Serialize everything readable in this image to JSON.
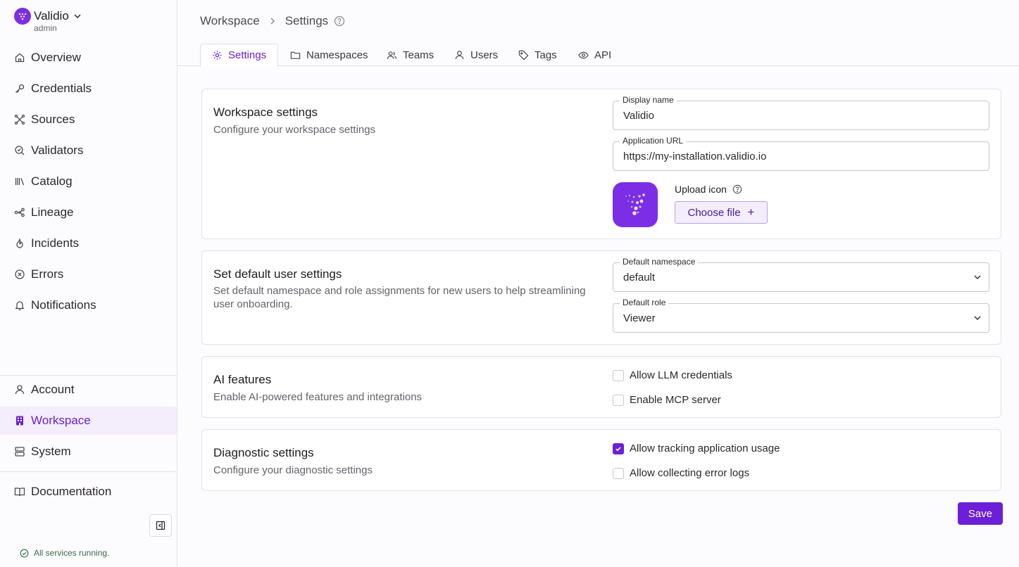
{
  "app": {
    "name": "Validio",
    "role": "admin"
  },
  "nav": {
    "main": [
      {
        "label": "Overview",
        "icon": "home-icon"
      },
      {
        "label": "Credentials",
        "icon": "key-icon"
      },
      {
        "label": "Sources",
        "icon": "sources-icon"
      },
      {
        "label": "Validators",
        "icon": "validator-icon"
      },
      {
        "label": "Catalog",
        "icon": "catalog-icon"
      },
      {
        "label": "Lineage",
        "icon": "lineage-icon"
      },
      {
        "label": "Incidents",
        "icon": "flame-icon"
      },
      {
        "label": "Errors",
        "icon": "error-icon"
      },
      {
        "label": "Notifications",
        "icon": "bell-icon"
      }
    ],
    "bottom": [
      {
        "label": "Account",
        "icon": "user-icon"
      },
      {
        "label": "Workspace",
        "icon": "building-icon",
        "active": true
      },
      {
        "label": "System",
        "icon": "server-icon"
      }
    ],
    "docs": {
      "label": "Documentation",
      "icon": "book-icon"
    }
  },
  "status": {
    "text": "All services running."
  },
  "breadcrumb": {
    "root": "Workspace",
    "current": "Settings"
  },
  "tabs": [
    {
      "label": "Settings",
      "icon": "gear-icon",
      "active": true
    },
    {
      "label": "Namespaces",
      "icon": "folder-icon"
    },
    {
      "label": "Teams",
      "icon": "users-icon"
    },
    {
      "label": "Users",
      "icon": "user-icon"
    },
    {
      "label": "Tags",
      "icon": "tag-icon"
    },
    {
      "label": "API",
      "icon": "eye-icon"
    }
  ],
  "workspace_settings": {
    "title": "Workspace settings",
    "description": "Configure your workspace settings",
    "display_name": {
      "label": "Display name",
      "value": "Validio"
    },
    "application_url": {
      "label": "Application URL",
      "value": "https://my-installation.validio.io"
    },
    "upload_icon_label": "Upload icon",
    "choose_file_label": "Choose file",
    "choose_file_plus": "+"
  },
  "default_user_settings": {
    "title": "Set default user settings",
    "description": "Set default namespace and role assignments for new users to help streamlining user onboarding.",
    "default_namespace": {
      "label": "Default namespace",
      "value": "default"
    },
    "default_role": {
      "label": "Default role",
      "value": "Viewer"
    }
  },
  "ai_features": {
    "title": "AI features",
    "description": "Enable AI-powered features and integrations",
    "options": [
      {
        "label": "Allow LLM credentials",
        "checked": false
      },
      {
        "label": "Enable MCP server",
        "checked": false
      }
    ]
  },
  "diagnostic_settings": {
    "title": "Diagnostic settings",
    "description": "Configure your diagnostic settings",
    "options": [
      {
        "label": "Allow tracking application usage",
        "checked": true
      },
      {
        "label": "Allow collecting error logs",
        "checked": false
      }
    ]
  },
  "save_label": "Save",
  "colors": {
    "accent": "#6c1fd6",
    "brand": "#7c2ee6",
    "active_bg": "#f3edfc",
    "success": "#3d6b4a"
  }
}
